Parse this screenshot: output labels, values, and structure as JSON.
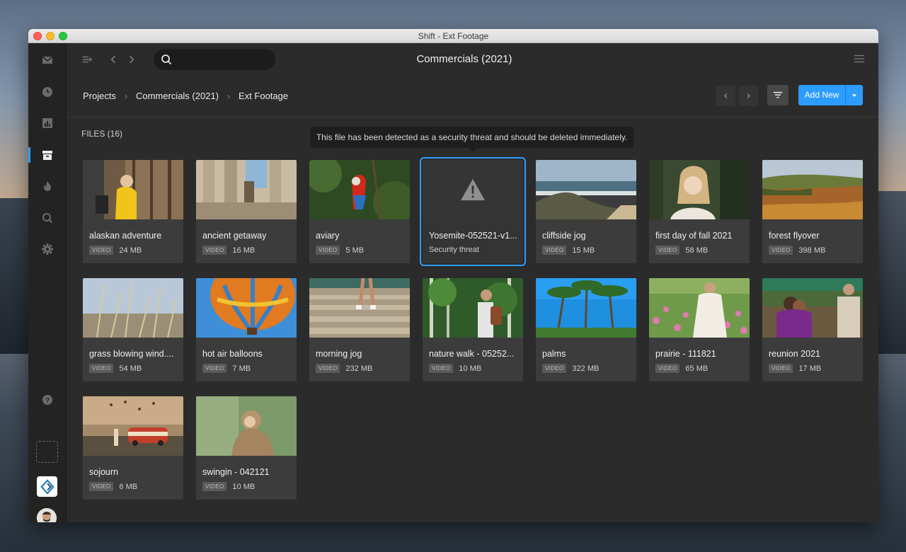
{
  "window": {
    "title": "Shift - Ext Footage"
  },
  "header": {
    "title": "Commercials (2021)",
    "search_placeholder": ""
  },
  "breadcrumb": [
    "Projects",
    "Commercials (2021)",
    "Ext Footage"
  ],
  "toolbar": {
    "add_new_label": "Add New"
  },
  "files": {
    "label": "FILES (16)",
    "tooltip": "This file has been detected as a security threat and should be deleted immediately."
  },
  "cards": [
    {
      "name": "alaskan adventure",
      "badge": "VIDEO",
      "size": "24 MB"
    },
    {
      "name": "ancient getaway",
      "badge": "VIDEO",
      "size": "16 MB"
    },
    {
      "name": "aviary",
      "badge": "VIDEO",
      "size": "5 MB"
    },
    {
      "name": "Yosemite-052521-v1...",
      "status": "Security threat"
    },
    {
      "name": "cliffside jog",
      "badge": "VIDEO",
      "size": "15 MB"
    },
    {
      "name": "first day of fall 2021",
      "badge": "VIDEO",
      "size": "58 MB"
    },
    {
      "name": "forest flyover",
      "badge": "VIDEO",
      "size": "398 MB"
    },
    {
      "name": "grass blowing wind....",
      "badge": "VIDEO",
      "size": "54 MB"
    },
    {
      "name": "hot air balloons",
      "badge": "VIDEO",
      "size": "7 MB"
    },
    {
      "name": "morning jog",
      "badge": "VIDEO",
      "size": "232 MB"
    },
    {
      "name": "nature walk - 05252...",
      "badge": "VIDEO",
      "size": "10 MB"
    },
    {
      "name": "palms",
      "badge": "VIDEO",
      "size": "322 MB"
    },
    {
      "name": "prairie - 111821",
      "badge": "VIDEO",
      "size": "65 MB"
    },
    {
      "name": "reunion 2021",
      "badge": "VIDEO",
      "size": "17 MB"
    },
    {
      "name": "sojourn",
      "badge": "VIDEO",
      "size": "6 MB"
    },
    {
      "name": "swingin - 042121",
      "badge": "VIDEO",
      "size": "10 MB"
    }
  ],
  "colors": {
    "accent": "#2d9cff",
    "background": "#2b2b2b",
    "sidebar": "#232323"
  },
  "icons": {
    "sidebar": [
      "mail-icon",
      "clock-icon",
      "chart-icon",
      "archive-icon",
      "flame-icon",
      "search-icon",
      "gear-icon",
      "help-icon"
    ],
    "header": [
      "collapse-sidebar-icon",
      "back-icon",
      "forward-icon",
      "list-menu-icon",
      "panel-icon"
    ]
  }
}
